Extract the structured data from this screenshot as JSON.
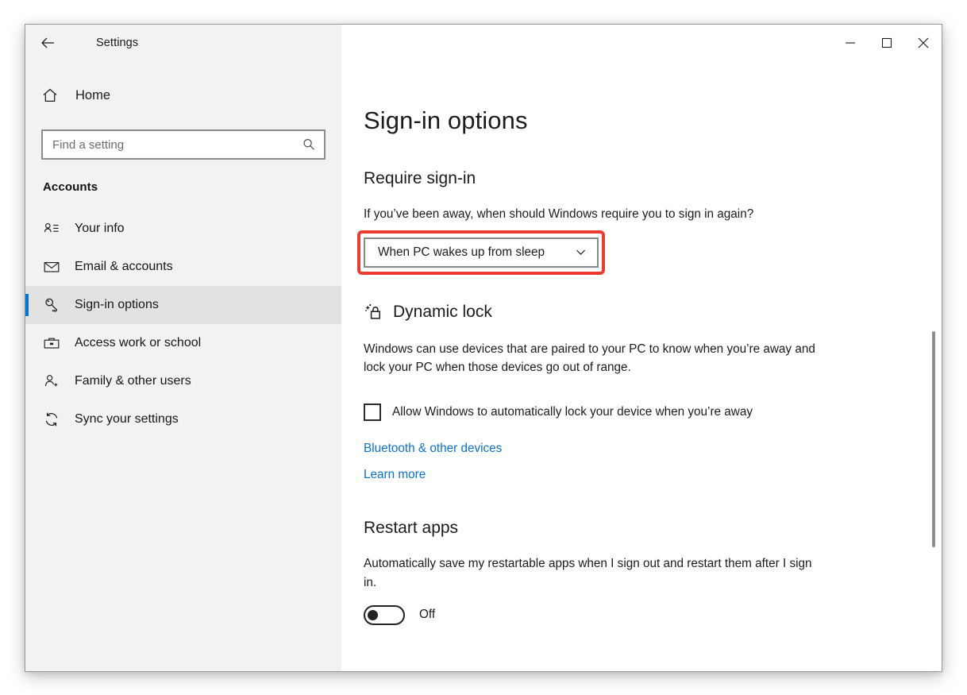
{
  "window": {
    "title": "Settings",
    "back_icon": "back-arrow-icon",
    "controls": {
      "minimize": "minimize-icon",
      "maximize": "maximize-icon",
      "close": "close-icon"
    }
  },
  "sidebar": {
    "home_label": "Home",
    "home_icon": "home-icon",
    "search": {
      "placeholder": "Find a setting",
      "value": "",
      "icon": "search-icon"
    },
    "group_title": "Accounts",
    "items": [
      {
        "label": "Your info",
        "icon": "user-card-icon",
        "selected": false
      },
      {
        "label": "Email & accounts",
        "icon": "envelope-icon",
        "selected": false
      },
      {
        "label": "Sign-in options",
        "icon": "key-icon",
        "selected": true
      },
      {
        "label": "Access work or school",
        "icon": "briefcase-icon",
        "selected": false
      },
      {
        "label": "Family & other users",
        "icon": "user-add-icon",
        "selected": false
      },
      {
        "label": "Sync your settings",
        "icon": "sync-icon",
        "selected": false
      }
    ]
  },
  "content": {
    "page_title": "Sign-in options",
    "require_signin": {
      "heading": "Require sign-in",
      "description": "If you’ve been away, when should Windows require you to sign in again?",
      "dropdown_value": "When PC wakes up from sleep",
      "dropdown_icon": "chevron-down-icon",
      "highlight_color": "#ee3b31"
    },
    "dynamic_lock": {
      "heading": "Dynamic lock",
      "icon": "padlock-sparkle-icon",
      "description": "Windows can use devices that are paired to your PC to know when you’re away and lock your PC when those devices go out of range.",
      "checkbox_label": "Allow Windows to automatically lock your device when you’re away",
      "checkbox_checked": false,
      "links": [
        {
          "label": "Bluetooth & other devices"
        },
        {
          "label": "Learn more"
        }
      ]
    },
    "restart_apps": {
      "heading": "Restart apps",
      "description": "Automatically save my restartable apps when I sign out and restart them after I sign in.",
      "toggle_state": "Off",
      "toggle_on": false
    }
  },
  "colors": {
    "accent": "#0078d7",
    "link": "#0a71c8",
    "sidebar_bg": "#f2f2f2",
    "highlight": "#ee3b31"
  }
}
